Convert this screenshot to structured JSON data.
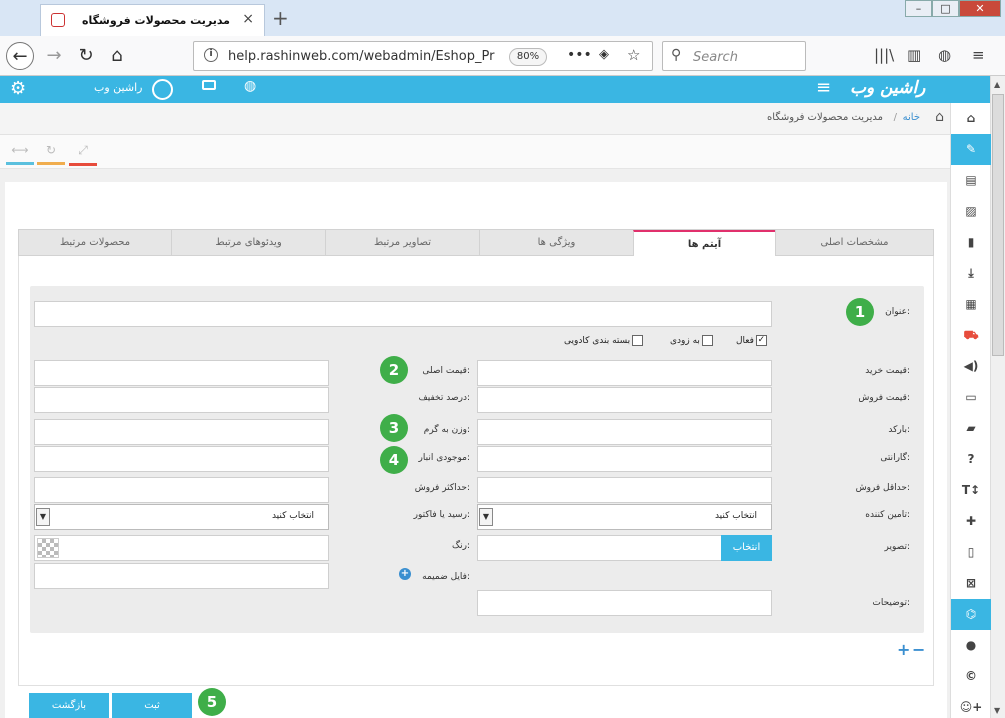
{
  "browser": {
    "tab_title": "مدیریت محصولات فروشگاه",
    "url": "help.rashinweb.com/webadmin/Eshop_Pr",
    "zoom": "80%",
    "search_placeholder": "Search"
  },
  "header": {
    "user_name": "راشین وب",
    "logo": "راشین وب"
  },
  "breadcrumb": {
    "home": "خانه",
    "current": "مدیریت محصولات فروشگاه"
  },
  "tabs": [
    "مشخصات اصلی",
    "آیتم ها",
    "ویژگی ها",
    "تصاویر مرتبط",
    "ویدئوهای مرتبط",
    "محصولات مرتبط"
  ],
  "active_tab": "آیتم ها",
  "form": {
    "title_label": "عنوان:",
    "checks": {
      "active": "فعال",
      "soon": "به زودی",
      "gift": "بسته بندی کادویی"
    },
    "buy_price": "قیمت خرید:",
    "original_price": "قیمت اصلی:",
    "sell_price": "قیمت فروش:",
    "discount": "درصد تخفیف:",
    "barcode": "بارکد:",
    "weight": "وزن به گرم:",
    "warranty": "گارانتی:",
    "stock": "موجودی انبار:",
    "min_sale": "حداقل فروش:",
    "max_sale": "حداکثر فروش:",
    "supplier": "تامین کننده:",
    "supplier_value": "انتخاب کنید",
    "invoice": "رسید یا فاکتور:",
    "invoice_value": "انتخاب کنید",
    "image": "تصویر:",
    "choose": "انتخاب",
    "color": "رنگ:",
    "attachment": "فایل ضمیمه:",
    "description": "توضیحات:"
  },
  "badges": [
    "1",
    "2",
    "3",
    "4",
    "5"
  ],
  "buttons": {
    "submit": "ثبت",
    "back": "بازگشت"
  },
  "colors": {
    "accent": "#3ab6e3",
    "badge": "#3fae49",
    "tab_active_border": "#e1306c"
  }
}
